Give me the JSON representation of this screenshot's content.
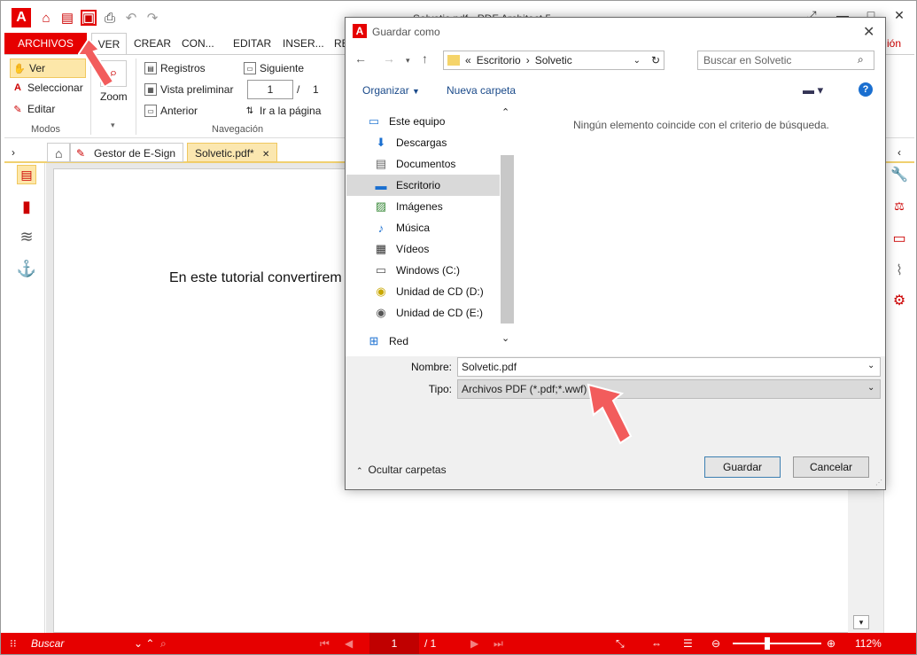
{
  "window": {
    "title": "Solvetic.pdf    -    PDF Architect 5",
    "min": "—",
    "max": "□",
    "close": "✕"
  },
  "ribbon_tabs": [
    "ARCHIVOS",
    "VER",
    "CREAR",
    "CON...",
    "EDITAR",
    "INSER...",
    "RE"
  ],
  "right_tab_fragment": "ión",
  "ribbon": {
    "modos": {
      "items": [
        "Ver",
        "Seleccionar",
        "Editar"
      ],
      "label": "Modos"
    },
    "zoom": {
      "label": "Zoom"
    },
    "navegacion": {
      "registros": "Registros",
      "vista_preliminar": "Vista preliminar",
      "anterior": "Anterior",
      "siguiente": "Siguiente",
      "page_value": "1",
      "page_sep": "/",
      "page_total": "1",
      "ir_a_pagina": "Ir a la página",
      "label": "Navegación"
    }
  },
  "doc_tabs": {
    "home": "⌂",
    "esign": "Gestor de E-Sign",
    "file": "Solvetic.pdf*",
    "close": "✕"
  },
  "document": {
    "text": "En este tutorial convertirem"
  },
  "statusbar": {
    "search_placeholder": "Buscar",
    "page_value": "1",
    "page_total": "/ 1",
    "zoom": "112%"
  },
  "dialog": {
    "title": "Guardar como",
    "close": "✕",
    "address": {
      "prefix": "«",
      "segments": [
        "Escritorio",
        "Solvetic"
      ]
    },
    "search_placeholder": "Buscar en Solvetic",
    "organize": "Organizar",
    "new_folder": "Nueva carpeta",
    "tree": [
      {
        "label": "Este equipo",
        "icon": "computer-icon"
      },
      {
        "label": "Descargas",
        "icon": "download-icon"
      },
      {
        "label": "Documentos",
        "icon": "documents-icon"
      },
      {
        "label": "Escritorio",
        "icon": "desktop-icon",
        "selected": true
      },
      {
        "label": "Imágenes",
        "icon": "pictures-icon"
      },
      {
        "label": "Música",
        "icon": "music-icon"
      },
      {
        "label": "Vídeos",
        "icon": "videos-icon"
      },
      {
        "label": "Windows (C:)",
        "icon": "drive-icon"
      },
      {
        "label": "Unidad de CD (D:)",
        "icon": "cd-icon"
      },
      {
        "label": "Unidad de CD (E:)",
        "icon": "cd-icon"
      }
    ],
    "network": "Red",
    "empty_message": "Ningún elemento coincide con el criterio de búsqueda.",
    "name_label": "Nombre:",
    "name_value": "Solvetic.pdf",
    "type_label": "Tipo:",
    "type_value": "Archivos PDF (*.pdf;*.wwf)",
    "hide_folders": "Ocultar carpetas",
    "save": "Guardar",
    "cancel": "Cancelar"
  },
  "colors": {
    "accent": "#e60000",
    "selection": "#cce4f7"
  }
}
